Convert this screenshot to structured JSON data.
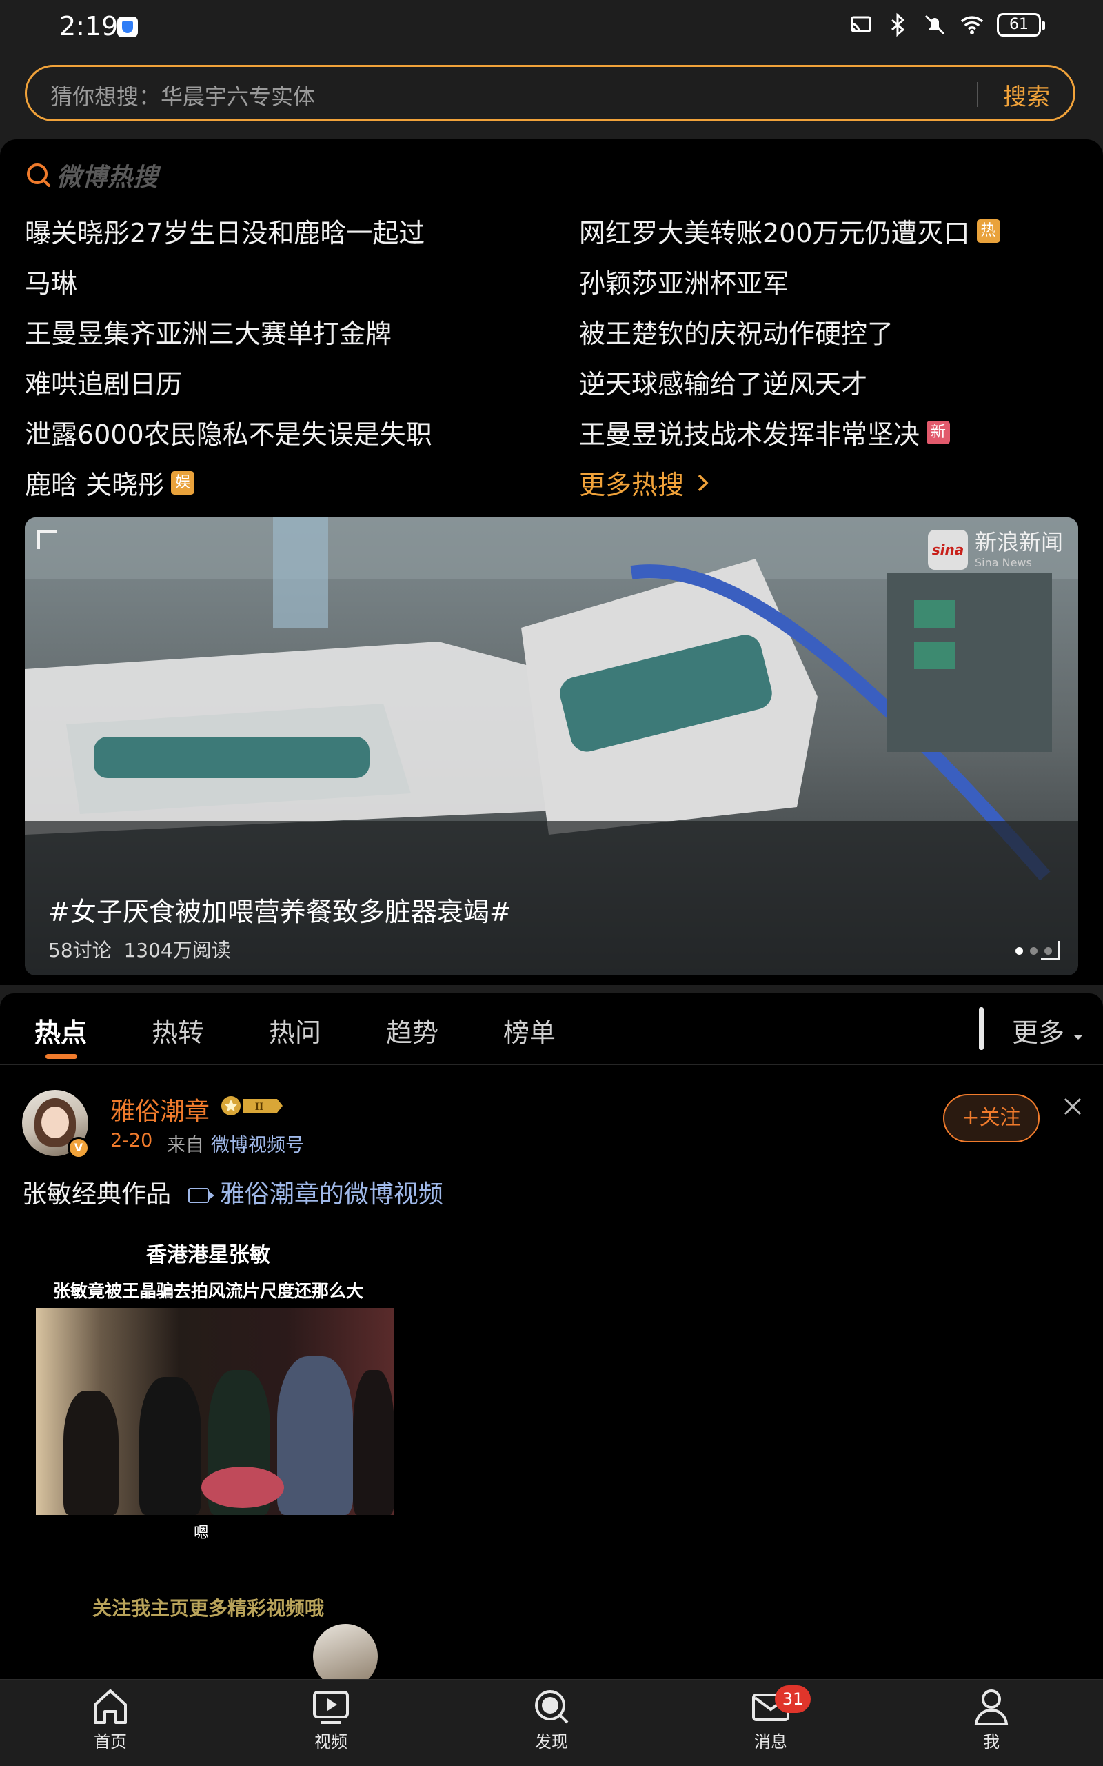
{
  "status_bar": {
    "time": "2:19",
    "battery": "61"
  },
  "search": {
    "placeholder": "猜你想搜：华晨宇六专实体",
    "button_label": "搜索"
  },
  "hot_search": {
    "logo_text": "微博热搜",
    "items": [
      {
        "text": "曝关晓彤27岁生日没和鹿晗一起过",
        "badge": ""
      },
      {
        "text": "网红罗大美转账200万元仍遭灭口",
        "badge": "热"
      },
      {
        "text": "马琳",
        "badge": ""
      },
      {
        "text": "孙颖莎亚洲杯亚军",
        "badge": ""
      },
      {
        "text": "王曼昱集齐亚洲三大赛单打金牌",
        "badge": ""
      },
      {
        "text": "被王楚钦的庆祝动作硬控了",
        "badge": ""
      },
      {
        "text": "难哄追剧日历",
        "badge": ""
      },
      {
        "text": "逆天球感输给了逆风天才",
        "badge": ""
      },
      {
        "text": "泄露6000农民隐私不是失误是失职",
        "badge": ""
      },
      {
        "text": "王曼昱说技战术发挥非常坚决",
        "badge": "新"
      },
      {
        "text": "鹿晗 关晓彤",
        "badge": "娱"
      }
    ],
    "more_label": "更多热搜"
  },
  "banner": {
    "source_name": "新浪新闻",
    "source_sub": "Sina News",
    "title": "#女子厌食被加喂营养餐致多脏器衰竭#",
    "discussions": "58讨论",
    "reads": "1304万阅读",
    "dots_total": 3,
    "dots_active": 1
  },
  "tabs": {
    "items": [
      "热点",
      "热转",
      "热问",
      "趋势",
      "榜单"
    ],
    "active": "热点",
    "more_label": "更多"
  },
  "post": {
    "author": "雅俗潮章",
    "date": "2-20",
    "from_label": "来自",
    "source": "微博视频号",
    "follow_label": "关注",
    "text": "张敏经典作品",
    "video_link": "雅俗潮章的微博视频",
    "video_card": {
      "title": "香港港星张敏",
      "subtitle": "张敏竟被王晶骗去拍风流片尺度还那么大",
      "caption": "嗯",
      "footer": "关注我主页更多精彩视频哦"
    }
  },
  "bottom_nav": {
    "items": [
      {
        "label": "首页",
        "icon": "home-icon"
      },
      {
        "label": "视频",
        "icon": "video-icon"
      },
      {
        "label": "发现",
        "icon": "discover-icon"
      },
      {
        "label": "消息",
        "icon": "message-icon",
        "badge": "31"
      },
      {
        "label": "我",
        "icon": "profile-icon"
      }
    ]
  },
  "colors": {
    "accent": "#f07b2c",
    "search_border": "#f0a23a",
    "link": "#9fb8e8",
    "badge_red": "#e0352b"
  }
}
